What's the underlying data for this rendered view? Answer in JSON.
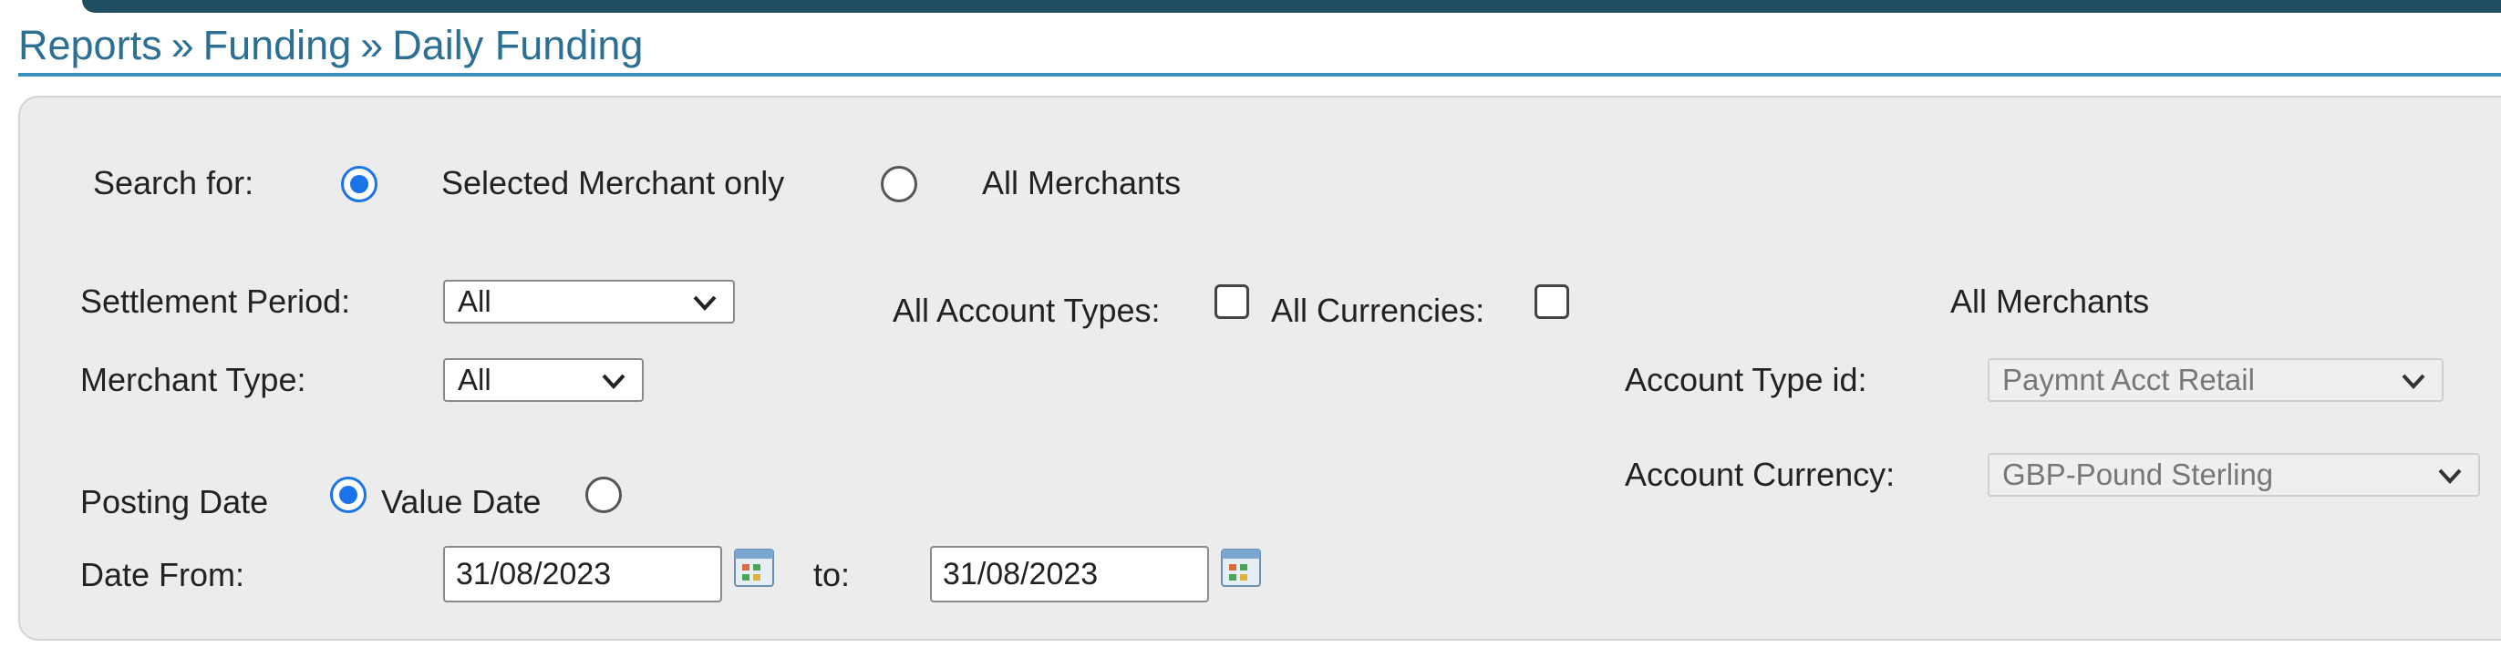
{
  "breadcrumb": {
    "items": [
      "Reports",
      "Funding",
      "Daily Funding"
    ],
    "separator": "»"
  },
  "search": {
    "label": "Search for:",
    "options": [
      {
        "label": "Selected Merchant only",
        "selected": true
      },
      {
        "label": "All Merchants",
        "selected": false
      }
    ]
  },
  "filters": {
    "settlement_period": {
      "label": "Settlement Period:",
      "value": "All"
    },
    "merchant_type": {
      "label": "Merchant Type:",
      "value": "All"
    },
    "all_account_types": {
      "label": "All Account Types:",
      "checked": false
    },
    "all_currencies": {
      "label": "All Currencies:",
      "checked": false
    }
  },
  "date_basis": {
    "options": [
      {
        "label": "Posting Date",
        "selected": true
      },
      {
        "label": "Value Date",
        "selected": false
      }
    ]
  },
  "date_range": {
    "from_label": "Date From:",
    "from_value": "31/08/2023",
    "to_label": "to:",
    "to_value": "31/08/2023"
  },
  "right_panel": {
    "heading": "All Merchants",
    "account_type": {
      "label": "Account Type id:",
      "value": "Paymnt Acct Retail"
    },
    "account_currency": {
      "label": "Account Currency:",
      "value": "GBP-Pound Sterling"
    }
  },
  "colors": {
    "topbar": "#1f4e63",
    "breadcrumb": "#2b6f94",
    "rule": "#3b8fbf",
    "radio_selected": "#1a73e8",
    "panel": "#ececec"
  },
  "icons": [
    "chevron-down-icon",
    "calendar-icon"
  ]
}
